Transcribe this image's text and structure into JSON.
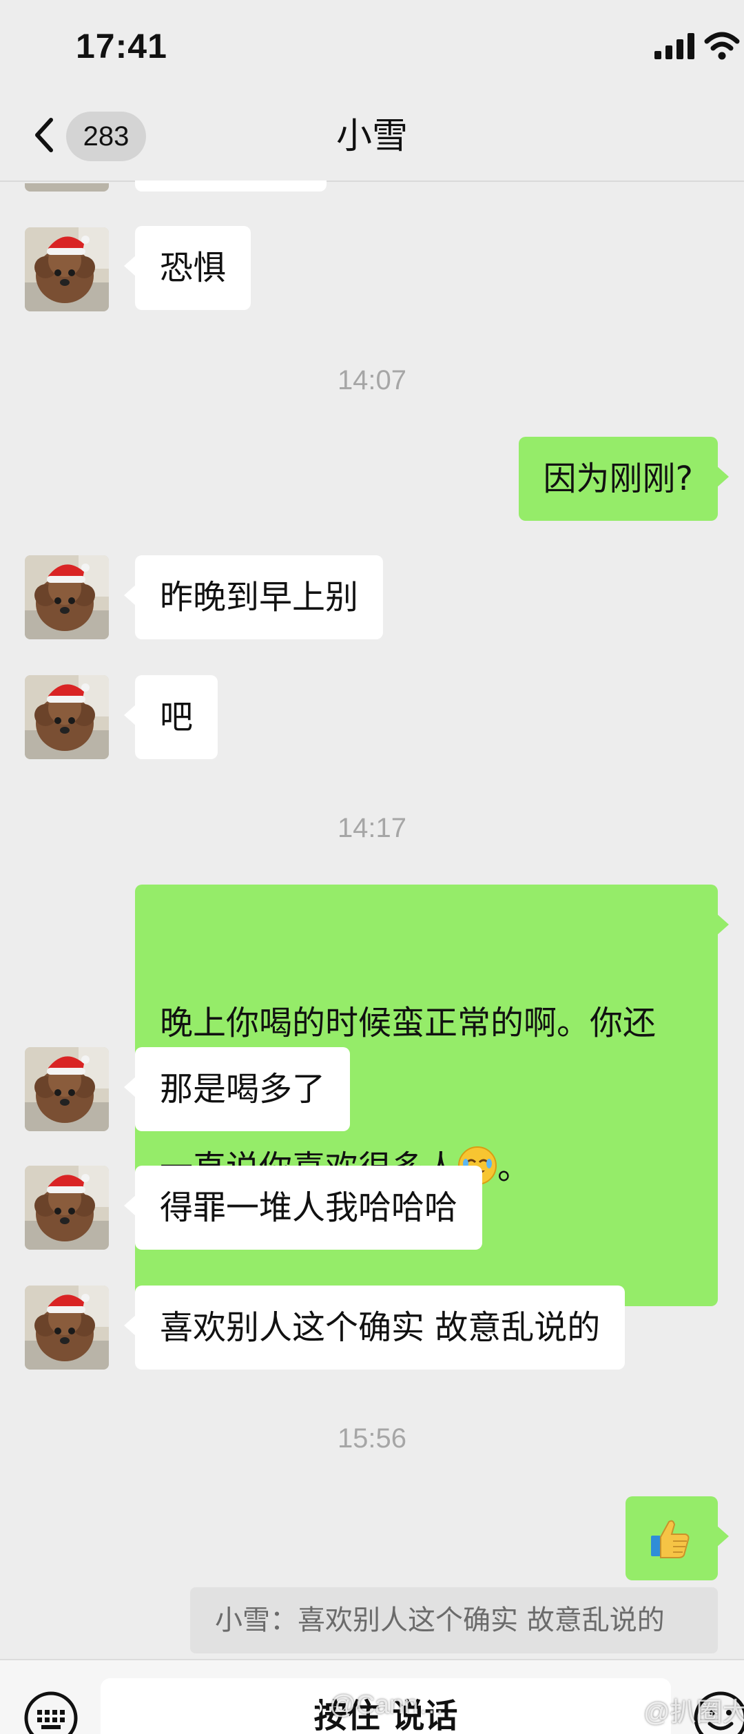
{
  "status_bar": {
    "time": "17:41"
  },
  "nav": {
    "unread_count": "283",
    "title": "小雪"
  },
  "messages": [
    {
      "side": "in",
      "text": "恐惧"
    },
    {
      "type": "time",
      "text": "14:07"
    },
    {
      "side": "out",
      "text": "因为刚刚?"
    },
    {
      "side": "in",
      "text": "昨晚到早上别"
    },
    {
      "side": "in",
      "text": "吧"
    },
    {
      "type": "time",
      "text": "14:17"
    },
    {
      "side": "out",
      "text_line1": "晚上你喝的时候蛮正常的啊。你还",
      "text_line2_before": "一直说你喜欢很多人",
      "text_line2_after": "。",
      "emoji": "facepalm-emoji"
    },
    {
      "side": "in",
      "text": "那是喝多了"
    },
    {
      "side": "in",
      "text": "得罪一堆人我哈哈哈"
    },
    {
      "side": "in",
      "text": "喜欢别人这个确实 故意乱说的"
    },
    {
      "type": "time",
      "text": "15:56"
    },
    {
      "side": "out",
      "emoji": "thumbs-up-emoji"
    }
  ],
  "quote": {
    "text": "小雪：喜欢别人这个确实 故意乱说的"
  },
  "input_bar": {
    "hold_to_talk": "按住 说话"
  },
  "watermarks": [
    "@Cann…",
    "@扒圈大神"
  ],
  "colors": {
    "background": "#ededed",
    "outgoing_bubble": "#95ec69",
    "incoming_bubble": "#ffffff",
    "timestamp": "#a6a6a6"
  }
}
